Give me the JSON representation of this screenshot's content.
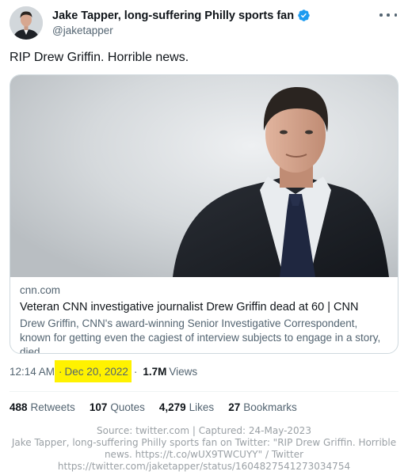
{
  "tweet": {
    "author": {
      "display_name": "Jake Tapper, long-suffering Philly sports fan",
      "handle": "@jaketapper",
      "verified": true,
      "avatar_icon": "profile-photo"
    },
    "more_icon": "more-horizontal-icon",
    "text": "RIP Drew Griffin. Horrible news.",
    "card": {
      "domain": "cnn.com",
      "title": "Veteran CNN investigative journalist Drew Griffin dead at 60 | CNN",
      "description": "Drew Griffin, CNN's award-winning Senior Investigative Correspondent, known for getting even the cagiest of interview subjects to engage in a story, died ...",
      "image_icon": "portrait-photo"
    },
    "time": "12:14 AM",
    "separator": "·",
    "date": "Dec 20, 2022",
    "views_count": "1.7M",
    "views_label": "Views",
    "stats": [
      {
        "count": "488",
        "label": "Retweets"
      },
      {
        "count": "107",
        "label": "Quotes"
      },
      {
        "count": "4,279",
        "label": "Likes"
      },
      {
        "count": "27",
        "label": "Bookmarks"
      }
    ]
  },
  "caption": {
    "line1": "Source: twitter.com | Captured: 24-May-2023",
    "line2": "Jake Tapper, long-suffering Philly sports fan on Twitter: \"RIP Drew Griffin. Horrible",
    "line3": "news. https://t.co/wUX9TWCUYY\" / Twitter",
    "line4": "https://twitter.com/jaketapper/status/1604827541273034754"
  },
  "colors": {
    "text_primary": "#0f1419",
    "text_secondary": "#536471",
    "verified_blue": "#1d9bf0",
    "date_highlight": "#fff200",
    "border": "#cfd9de"
  }
}
